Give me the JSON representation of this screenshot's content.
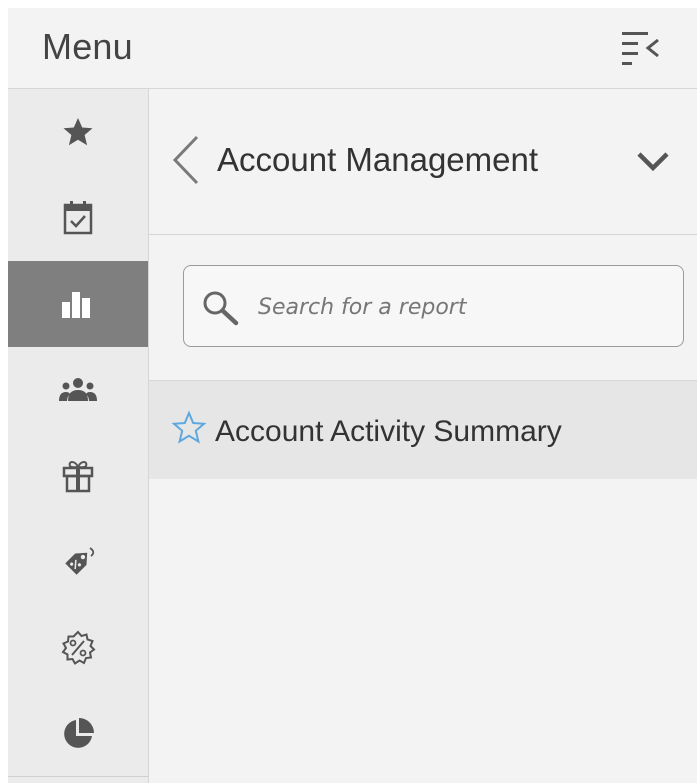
{
  "header": {
    "title": "Menu",
    "collapse_icon": "collapse-menu-icon"
  },
  "rail": {
    "items": [
      {
        "icon": "star-icon",
        "active": false
      },
      {
        "icon": "calendar-check-icon",
        "active": false
      },
      {
        "icon": "bar-chart-icon",
        "active": true
      },
      {
        "icon": "people-icon",
        "active": false
      },
      {
        "icon": "gift-icon",
        "active": false
      },
      {
        "icon": "discount-tag-icon",
        "active": false
      },
      {
        "icon": "percent-badge-icon",
        "active": false
      },
      {
        "icon": "pie-chart-icon",
        "active": false
      }
    ]
  },
  "section": {
    "title": "Account Management",
    "back_icon": "chevron-left-icon",
    "expand_icon": "chevron-down-icon"
  },
  "search": {
    "placeholder": "Search for a report",
    "value": ""
  },
  "reports": [
    {
      "label": "Account Activity Summary",
      "favorite_icon": "star-outline-icon"
    }
  ],
  "colors": {
    "active_rail": "#7f7f7f",
    "favorite_star": "#5ea8e0",
    "icon_gray": "#555555"
  }
}
